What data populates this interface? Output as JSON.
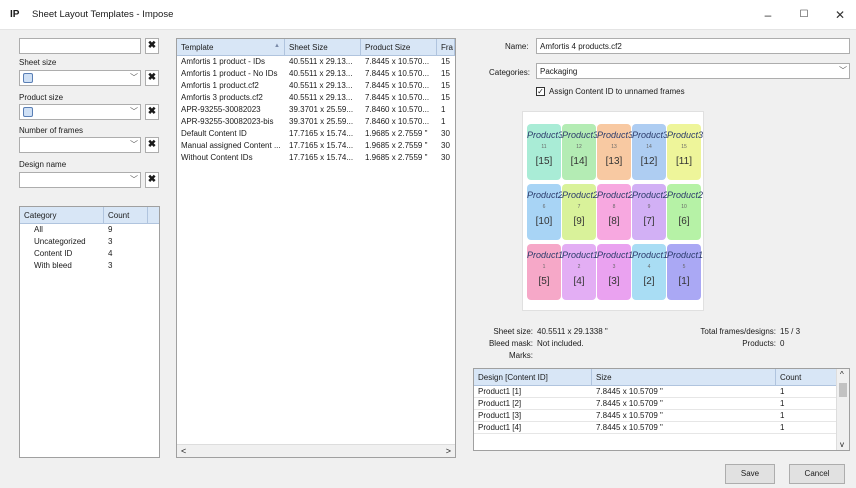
{
  "window": {
    "app_icon": "IP",
    "title": "Sheet Layout Templates - Impose",
    "minimize": "–",
    "maximize": "☐",
    "close": "✕"
  },
  "filters": {
    "search_value": "",
    "sheet_size_label": "Sheet size",
    "product_size_label": "Product size",
    "frames_label": "Number of frames",
    "design_label": "Design name",
    "clear": "✖",
    "arrow": "﹀"
  },
  "category_table": {
    "headers": [
      "Category",
      "Count"
    ],
    "rows": [
      [
        "All",
        "9"
      ],
      [
        "Uncategorized",
        "3"
      ],
      [
        "Content ID",
        "4"
      ],
      [
        "With bleed",
        "3"
      ]
    ]
  },
  "template_table": {
    "headers": [
      "Template",
      "Sheet Size",
      "Product Size",
      "Fra"
    ],
    "sort_icon": "▲",
    "rows": [
      [
        "Amfortis 1 product - IDs",
        "40.5511 x 29.13...",
        "7.8445 x 10.570...",
        "15"
      ],
      [
        "Amfortis 1 product - No IDs",
        "40.5511 x 29.13...",
        "7.8445 x 10.570...",
        "15"
      ],
      [
        "Amfortis 1 product.cf2",
        "40.5511 x 29.13...",
        "7.8445 x 10.570...",
        "15"
      ],
      [
        "Amfortis 3 products.cf2",
        "40.5511 x 29.13...",
        "7.8445 x 10.570...",
        "15"
      ],
      [
        "APR-93255-30082023",
        "39.3701 x 25.59...",
        "7.8460 x 10.570...",
        "1"
      ],
      [
        "APR-93255-30082023-bis",
        "39.3701 x 25.59...",
        "7.8460 x 10.570...",
        "1"
      ],
      [
        "Default Content ID",
        "17.7165 x 15.74...",
        "1.9685 x 2.7559 \"",
        "30"
      ],
      [
        "Manual assigned Content ...",
        "17.7165 x 15.74...",
        "1.9685 x 2.7559 \"",
        "30"
      ],
      [
        "Without Content IDs",
        "17.7165 x 15.74...",
        "1.9685 x 2.7559 \"",
        "30"
      ]
    ],
    "scroll_left": "<",
    "scroll_right": ">"
  },
  "details": {
    "name_label": "Name:",
    "name_value": "Amfortis 4 products.cf2",
    "categories_label": "Categories:",
    "categories_value": "Packaging",
    "assign_checkbox_label": "Assign Content ID to unnamed frames",
    "assign_checked": "✓",
    "sheet_size_label": "Sheet size:",
    "sheet_size_value": "40.5511 x 29.1338 \"",
    "bleed_label": "Bleed mask:",
    "bleed_value": "Not included.",
    "marks_label": "Marks:",
    "total_frames_label": "Total frames/designs:",
    "total_frames_value": "15 / 3",
    "products_label": "Products:",
    "products_value": "0"
  },
  "preview": {
    "rows": [
      {
        "name": "Product3",
        "nums": [
          "[15]",
          "[14]",
          "[13]",
          "[12]",
          "[11]"
        ],
        "dots": [
          "11",
          "12",
          "13",
          "14",
          "15"
        ],
        "colors": [
          "#a9ecd6",
          "#b4ecb4",
          "#f8c9a2",
          "#aecdf2",
          "#eef59a"
        ]
      },
      {
        "name": "Product2",
        "nums": [
          "[10]",
          "[9]",
          "[8]",
          "[7]",
          "[6]"
        ],
        "dots": [
          "6",
          "7",
          "8",
          "9",
          "10"
        ],
        "colors": [
          "#a8d4f5",
          "#d9f29a",
          "#f7a8e0",
          "#d2b0f5",
          "#b6f2a6"
        ]
      },
      {
        "name": "Product1",
        "nums": [
          "[5]",
          "[4]",
          "[3]",
          "[2]",
          "[1]"
        ],
        "dots": [
          "1",
          "2",
          "3",
          "4",
          "5"
        ],
        "colors": [
          "#f6a8c8",
          "#e3aef4",
          "#eaa2f0",
          "#a9ddf4",
          "#aaa8f4"
        ]
      }
    ]
  },
  "design_table": {
    "headers": [
      "Design [Content ID]",
      "Size",
      "Count"
    ],
    "rows": [
      [
        "Product1 [1]",
        "7.8445 x 10.5709 \"",
        "1"
      ],
      [
        "Product1 [2]",
        "7.8445 x 10.5709 \"",
        "1"
      ],
      [
        "Product1 [3]",
        "7.8445 x 10.5709 \"",
        "1"
      ],
      [
        "Product1 [4]",
        "7.8445 x 10.5709 \"",
        "1"
      ]
    ],
    "scroll_up": "^",
    "scroll_down": "v"
  },
  "buttons": {
    "save": "Save",
    "cancel": "Cancel"
  }
}
